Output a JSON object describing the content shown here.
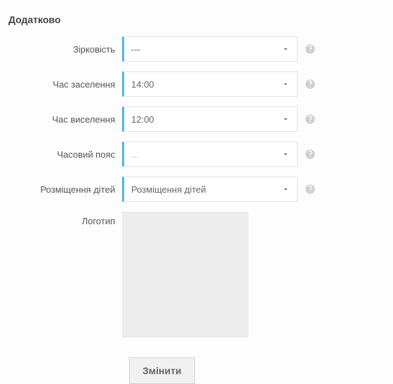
{
  "section": {
    "title": "Додатково"
  },
  "fields": {
    "stars": {
      "label": "Зірковість",
      "value": "---",
      "placeholder": false
    },
    "checkin": {
      "label": "Час заселення",
      "value": "14:00",
      "placeholder": false
    },
    "checkout": {
      "label": "Час виселення",
      "value": "12:00",
      "placeholder": false
    },
    "tz": {
      "label": "Часовий пояс",
      "value": "...",
      "placeholder": true
    },
    "kids": {
      "label": "Розміщення дітей",
      "value": "Розміщення дітей",
      "placeholder": false
    },
    "logo": {
      "label": "Логотип"
    }
  },
  "buttons": {
    "change": "Змінити"
  }
}
